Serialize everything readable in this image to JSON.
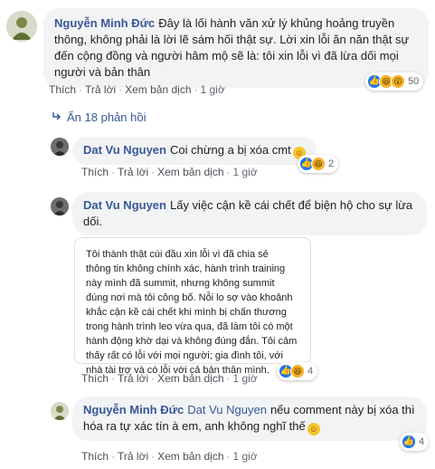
{
  "comment1": {
    "author": "Nguyễn Minh Đức",
    "text": "Đây là lối hành văn xử lý khủng hoảng truyền thông, không phải là lời lẽ sám hối thật sự. Lời xin lỗi ăn năn thật sự đến cộng đồng và người hâm mộ sẽ là: tôi xin lỗi vì đã lừa dối mọi người và bản thân",
    "actions": {
      "like": "Thích",
      "reply": "Trả lời",
      "translate": "Xem bản dịch",
      "time": "1 giờ"
    },
    "reaction_count": "50",
    "reaction_icons": [
      "like-icon",
      "haha-icon",
      "wow-icon"
    ]
  },
  "hidden_replies": {
    "label": "Ẩn 18 phản hồi",
    "icon": "reply-arrow-icon"
  },
  "reply1": {
    "author": "Dat Vu Nguyen",
    "text": "Coi chừng a bị xóa cmt",
    "emoji": "grinning-sweat-emoji",
    "actions": {
      "like": "Thích",
      "reply": "Trả lời",
      "translate": "Xem bản dịch",
      "time": "1 giờ"
    },
    "reaction_count": "2",
    "reaction_icons": [
      "like-icon",
      "haha-icon"
    ]
  },
  "reply2": {
    "author": "Dat Vu Nguyen",
    "text": "Lấy việc cận kề cái chết để biện hộ cho sự lừa dối.",
    "image_lines": [
      "Tôi thành thật cúi đầu xin lỗi vì đã chia sẻ",
      "thông tin không chính xác, hành trình training",
      "này mình đã summit, nhưng không summit",
      "đúng nơi mà tôi công bố. Nỗi lo sợ vào khoảnh",
      "khắc cận kề cái chết khi mình bị chấn thương",
      "trong hành trình leo vừa qua, đã làm tôi có một",
      "hành động khờ dại và không đúng đắn. Tôi cảm",
      "thấy rất có lỗi với mọi người; gia đình tôi, với",
      "nhà tài trợ và có lỗi với cả bản thân mình."
    ],
    "actions": {
      "like": "Thích",
      "reply": "Trả lời",
      "translate": "Xem bản dịch",
      "time": "1 giờ"
    },
    "reaction_count": "4",
    "reaction_icons": [
      "like-icon",
      "haha-icon"
    ]
  },
  "reply3": {
    "author": "Nguyễn Minh Đức",
    "mention": "Dat Vu Nguyen",
    "text": "nếu comment này bị xóa thì hóa ra tự xác tín à em, anh không nghĩ thế",
    "emoji": "smile-emoji",
    "actions": {
      "like": "Thích",
      "reply": "Trả lời",
      "translate": "Xem bản dịch",
      "time": "1 giờ"
    },
    "reaction_count": "4",
    "reaction_icons": [
      "like-icon"
    ]
  },
  "colors": {
    "link": "#385898",
    "bubble": "#f2f3f5",
    "like": "#1877f2",
    "haha": "#f7b125"
  }
}
